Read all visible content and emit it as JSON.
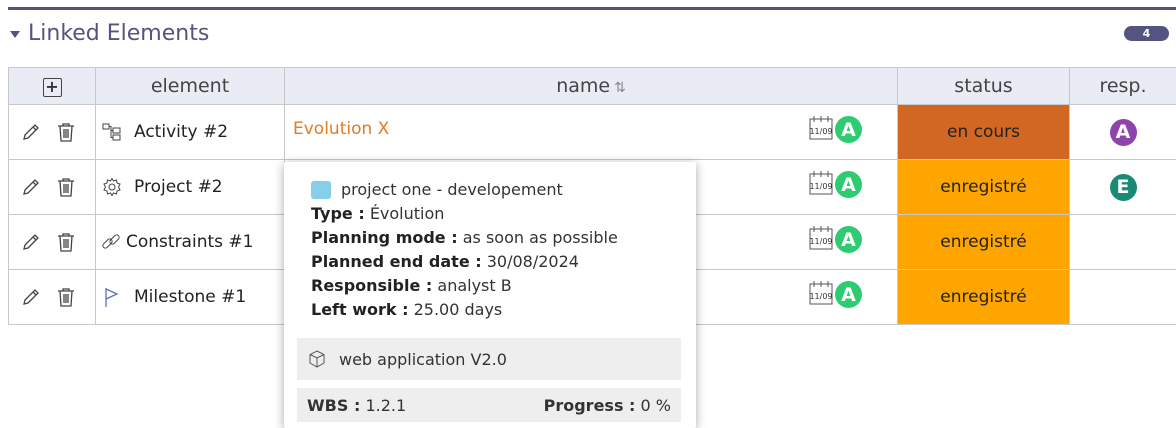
{
  "section": {
    "title": "Linked Elements",
    "count": "4"
  },
  "table": {
    "headers": {
      "add": "+",
      "element": "element",
      "name": "name",
      "name_sort": "⇅",
      "status": "status",
      "resp": "resp."
    },
    "rows": [
      {
        "element_icon": "activity-icon",
        "element": "Activity #2",
        "name": "Evolution X",
        "name_avatar": "A",
        "status": "en cours",
        "status_color": "#d26623",
        "resp": "A",
        "resp_color": "#8e44ad"
      },
      {
        "element_icon": "gear-icon",
        "element": "Project #2",
        "name": "",
        "name_avatar": "A",
        "status": "enregistré",
        "status_color": "#ffa500",
        "resp": "E",
        "resp_color": "#1a8a74"
      },
      {
        "element_icon": "link-icon",
        "element": "Constraints #1",
        "name": "",
        "name_avatar": "A",
        "status": "enregistré",
        "status_color": "#ffa500",
        "resp": "",
        "resp_color": ""
      },
      {
        "element_icon": "flag-icon",
        "element": "Milestone #1",
        "name": "",
        "name_avatar": "A",
        "status": "enregistré",
        "status_color": "#ffa500",
        "resp": "",
        "resp_color": ""
      }
    ],
    "calendar_icon_text": "11/09"
  },
  "tooltip": {
    "project": "project one - developement",
    "project_color": "#87ceeb",
    "type_label": "Type :",
    "type_value": "Évolution",
    "planning_label": "Planning mode :",
    "planning_value": "as soon as possible",
    "end_label": "Planned end date :",
    "end_value": "30/08/2024",
    "resp_label": "Responsible :",
    "resp_value": "analyst B",
    "left_label": "Left work :",
    "left_value": "25.00 days",
    "product": "web application V2.0",
    "wbs_label": "WBS :",
    "wbs_value": "1.2.1",
    "progress_label": "Progress :",
    "progress_value": "0 %"
  }
}
